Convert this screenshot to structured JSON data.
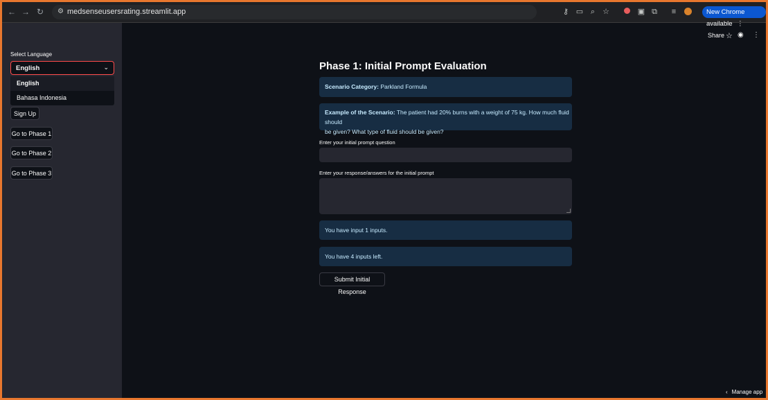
{
  "browser": {
    "url": "medsenseusersrating.streamlit.app",
    "update_label": "New Chrome available"
  },
  "sidebar": {
    "select_label": "Select Language",
    "selected_language": "English",
    "options": [
      "English",
      "Bahasa Indonesia"
    ],
    "signup_label": "Sign Up",
    "phase1_label": "Go to Phase 1",
    "phase2_label": "Go to Phase 2",
    "phase3_label": "Go to Phase 3"
  },
  "header": {
    "share_label": "Share"
  },
  "main": {
    "title": "Phase 1: Initial Prompt Evaluation",
    "category_label": "Scenario Category:",
    "category_value": "Parkland Formula",
    "example_label": "Example of the Scenario:",
    "example_line1": "The patient had 20% burns with a weight of 75 kg. How much fluid should",
    "example_line2": "be given? What type of fluid should be given?",
    "question_label": "Enter your initial prompt question",
    "question_value": "",
    "response_label": "Enter your response/answers for the initial prompt",
    "response_value": "",
    "inputs_done": "You have input 1 inputs.",
    "inputs_left": "You have 4 inputs left.",
    "submit_label": "Submit Initial Response"
  },
  "footer": {
    "manage_label": "Manage app"
  },
  "colors": {
    "accent": "#ff4b4b",
    "info_bg": "#172d43",
    "info_text": "#c7ebff",
    "app_bg": "#0e1117",
    "sidebar_bg": "#262730"
  }
}
